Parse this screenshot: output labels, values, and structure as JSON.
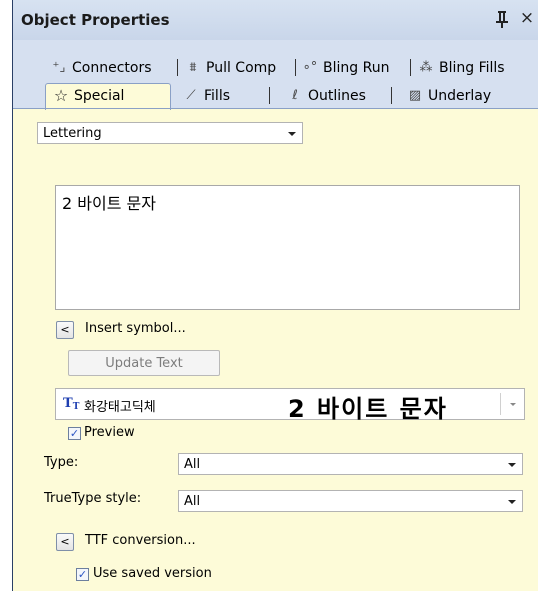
{
  "window": {
    "title": "Object Properties",
    "pin_glyph": "ᵽ",
    "close_glyph": "×"
  },
  "tabs_row1": [
    {
      "label": "Connectors",
      "icon": "connectors-icon"
    },
    {
      "label": "Pull Comp",
      "icon": "pull-comp-icon"
    },
    {
      "label": "Bling Run",
      "icon": "bling-run-icon"
    },
    {
      "label": "Bling Fills",
      "icon": "bling-fills-icon"
    }
  ],
  "tabs_row2": [
    {
      "label": "Special",
      "icon": "star-icon",
      "active": true
    },
    {
      "label": "Fills",
      "icon": "fills-icon"
    },
    {
      "label": "Outlines",
      "icon": "outlines-icon"
    },
    {
      "label": "Underlay",
      "icon": "underlay-icon"
    }
  ],
  "object_type": {
    "selected": "Lettering"
  },
  "lettering_text": "2 바이트 문자",
  "insert_symbol": {
    "button": "<",
    "label": "Insert symbol..."
  },
  "update_text_button": "Update Text",
  "font": {
    "name": "화강태고딕체",
    "preview": "2 바이트 문자",
    "type_badge": "T"
  },
  "preview_checkbox": {
    "label": "Preview",
    "checked": true
  },
  "type_field": {
    "label": "Type:",
    "selected": "All"
  },
  "truetype_style": {
    "label": "TrueType style:",
    "selected": "All"
  },
  "ttf_conversion": {
    "button": "<",
    "label": "TTF conversion..."
  },
  "use_saved_version": {
    "label": "Use saved version",
    "checked": true
  },
  "colors": {
    "panel_bg": "#fdfbd8",
    "titlebar": "#c9d6ea",
    "tab_strip": "#d6e0f0",
    "accent": "#2b55c3"
  }
}
